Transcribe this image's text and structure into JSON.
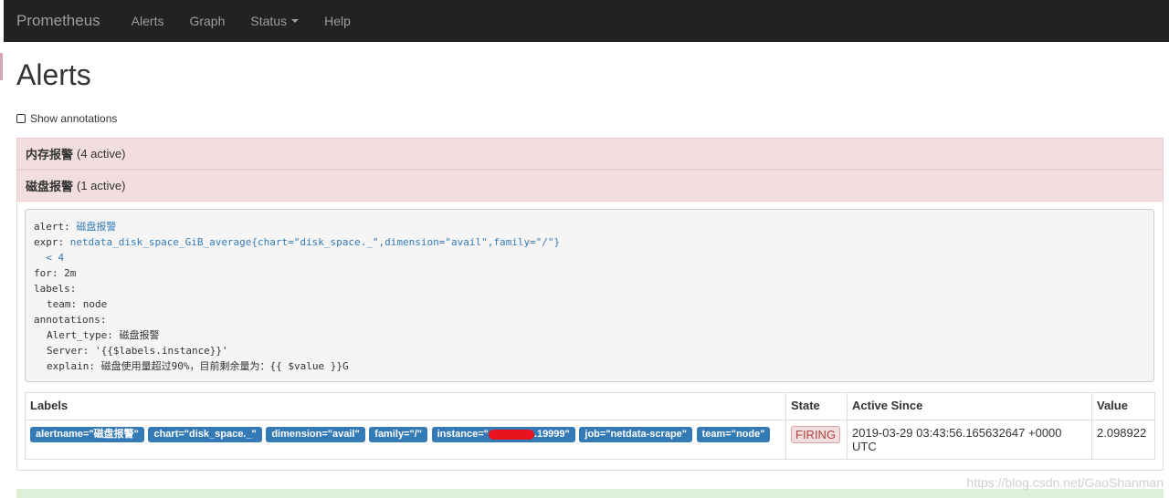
{
  "navbar": {
    "brand": "Prometheus",
    "items": [
      "Alerts",
      "Graph",
      "Status",
      "Help"
    ]
  },
  "page_title": "Alerts",
  "show_annotations_label": "Show annotations",
  "groups": [
    {
      "name": "内存报警",
      "count": "(4 active)"
    },
    {
      "name": "磁盘报警",
      "count": "(1 active)"
    }
  ],
  "rule": {
    "alert_key": "alert:",
    "alert_value": "磁盘报警",
    "expr_key": "expr:",
    "expr_value": "netdata_disk_space_GiB_average{chart=\"disk_space._\",dimension=\"avail\",family=\"/\"}",
    "expr_cont": "< 4",
    "for_line": "for: 2m",
    "labels_line": "labels:",
    "team_line": "team: node",
    "annotations_line": "annotations:",
    "alert_type_line": "Alert_type: 磁盘报警",
    "server_line": "Server: '{{$labels.instance}}'",
    "explain_line": "explain: 磁盘使用量超过90%，目前剩余量为：{{ $value }}G"
  },
  "table": {
    "headers": [
      "Labels",
      "State",
      "Active Since",
      "Value"
    ],
    "row": {
      "labels": [
        "alertname=\"磁盘报警\"",
        "chart=\"disk_space._\"",
        "dimension=\"avail\"",
        "family=\"/\"",
        "job=\"netdata-scrape\"",
        "team=\"node\""
      ],
      "instance_prefix": "instance=\"",
      "instance_suffix": ".19999\"",
      "state": "FIRING",
      "active_since": "2019-03-29 03:43:56.165632647 +0000 UTC",
      "value": "2.098922"
    }
  },
  "watermark": "https://blog.csdn.net/GaoShanman"
}
